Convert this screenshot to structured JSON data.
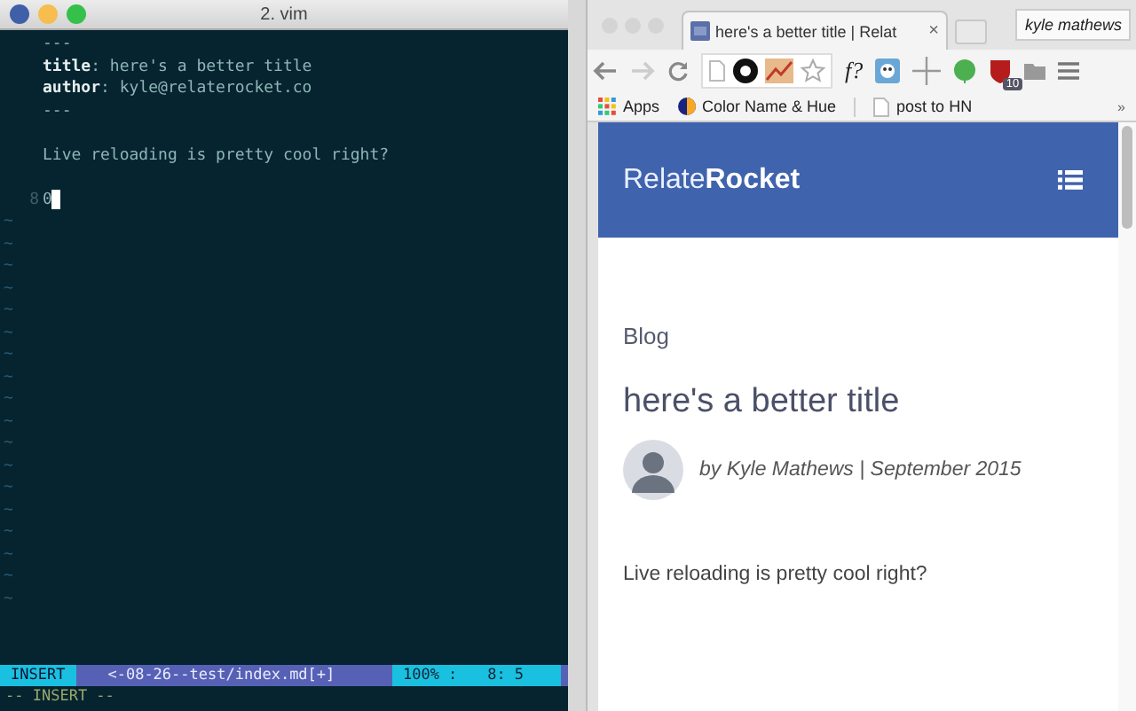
{
  "terminal": {
    "title": "2. vim",
    "lines": [
      {
        "kind": "text",
        "text": "---"
      },
      {
        "kind": "text",
        "text": "**title**: here's a better title"
      },
      {
        "kind": "text",
        "text": "**author**: kyle@relaterocket.co"
      },
      {
        "kind": "text",
        "text": "---"
      },
      {
        "kind": "blank"
      },
      {
        "kind": "text",
        "text": "Live reloading is pretty cool right?"
      },
      {
        "kind": "blank"
      },
      {
        "kind": "text",
        "number": "8",
        "text": "0",
        "cursor": true
      }
    ],
    "tildes": [
      "~",
      "~",
      "~",
      "~",
      "~",
      "~",
      "~",
      "~",
      "~",
      "~",
      "~",
      "~",
      "~",
      "~",
      "~",
      "~",
      "~",
      "~"
    ],
    "status_line": {
      "mode": "INSERT",
      "file": "<-08-26--test/index.md[+]",
      "percent": "100%",
      "separator": ":",
      "line": "8:",
      "column": "5"
    },
    "command_line": "-- INSERT --"
  },
  "browser": {
    "tab": {
      "title": "here's a better title | Relat",
      "close": "×"
    },
    "profile": "kyle mathews",
    "toolbar": {
      "formula_button": "f?",
      "badge": "10"
    },
    "bookmarks": [
      {
        "label": "Apps"
      },
      {
        "label": "Color Name & Hue"
      },
      {
        "label": "post to HN"
      }
    ],
    "bookmarks_more": "»",
    "page": {
      "logo": "Relate**Rocket**",
      "section": "Blog",
      "title": "here's a better title",
      "byline": "by Kyle Mathews | September 2015",
      "body": "Live reloading is pretty cool right?"
    }
  }
}
